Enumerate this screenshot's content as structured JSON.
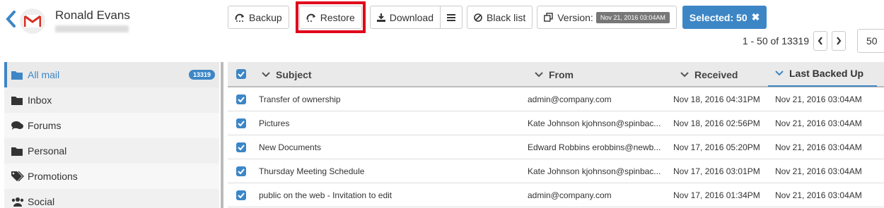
{
  "user": {
    "name": "Ronald Evans"
  },
  "toolbar": {
    "backup": "Backup",
    "restore": "Restore",
    "download": "Download",
    "blacklist": "Black list",
    "version_label": "Version:",
    "version_value": "Nov 21, 2016 03:04AM",
    "selected": "Selected: 50"
  },
  "pager": {
    "range": "1 - 50 of 13319",
    "page_size": "50"
  },
  "sidebar": {
    "items": [
      {
        "label": "All mail",
        "count": "13319",
        "icon": "folder-icon"
      },
      {
        "label": "Inbox",
        "icon": "folder-icon"
      },
      {
        "label": "Forums",
        "icon": "comments-icon"
      },
      {
        "label": "Personal",
        "icon": "folder-icon"
      },
      {
        "label": "Promotions",
        "icon": "tag-icon"
      },
      {
        "label": "Social",
        "icon": "users-icon"
      }
    ]
  },
  "table": {
    "headers": {
      "subject": "Subject",
      "from": "From",
      "received": "Received",
      "backed": "Last Backed Up"
    },
    "rows": [
      {
        "subject": "Transfer of ownership",
        "from": "admin@company.com",
        "received": "Nov 18, 2016 04:31PM",
        "backed": "Nov 21, 2016 03:04AM"
      },
      {
        "subject": "Pictures",
        "from": "Kate Johnson kjohnson@spinbac...",
        "received": "Nov 18, 2016 02:56PM",
        "backed": "Nov 21, 2016 03:04AM"
      },
      {
        "subject": "New Documents",
        "from": "Edward Robbins erobbins@newb...",
        "received": "Nov 17, 2016 05:20PM",
        "backed": "Nov 21, 2016 03:04AM"
      },
      {
        "subject": "Thursday Meeting Schedule",
        "from": "Kate Johnson kjohnson@spinbac...",
        "received": "Nov 17, 2016 03:01PM",
        "backed": "Nov 21, 2016 03:04AM"
      },
      {
        "subject": "public on the web - Invitation to edit",
        "from": "admin@company.com",
        "received": "Nov 17, 2016 01:34PM",
        "backed": "Nov 21, 2016 03:04AM"
      }
    ]
  },
  "colors": {
    "accent": "#3d86c6",
    "highlight": "#e0001b"
  }
}
